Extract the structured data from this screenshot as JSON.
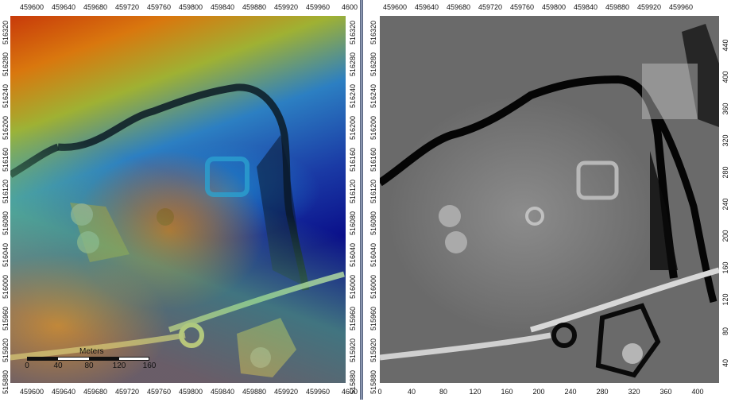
{
  "left_panel": {
    "x_axis_top": [
      "459600",
      "459640",
      "459680",
      "459720",
      "459760",
      "459800",
      "459840",
      "459880",
      "459920",
      "459960",
      "4600"
    ],
    "x_axis_bottom": [
      "459600",
      "459640",
      "459680",
      "459720",
      "459760",
      "459800",
      "459840",
      "459880",
      "459920",
      "459960",
      "4600"
    ],
    "y_axis": [
      "516320",
      "516280",
      "516240",
      "516200",
      "516160",
      "516120",
      "516080",
      "516040",
      "516000",
      "515960",
      "515920",
      "515880"
    ],
    "scale": {
      "title": "Meters",
      "labels": [
        "0",
        "40",
        "80",
        "120",
        "160"
      ]
    }
  },
  "right_panel": {
    "x_axis_top": [
      "459600",
      "459640",
      "459680",
      "459720",
      "459760",
      "459800",
      "459840",
      "459880",
      "459920",
      "459960"
    ],
    "y_axis_left": [
      "516320",
      "516280",
      "516240",
      "516200",
      "516160",
      "516120",
      "516080",
      "516040",
      "516000",
      "515960",
      "515920",
      "515880"
    ],
    "x_axis_bottom": [
      "0",
      "40",
      "80",
      "120",
      "160",
      "200",
      "240",
      "280",
      "320",
      "360",
      "400"
    ],
    "y_axis_right": [
      "440",
      "400",
      "360",
      "320",
      "280",
      "240",
      "200",
      "160",
      "120",
      "80",
      "40"
    ]
  },
  "colors": {
    "dem_high": "#c83a0a",
    "dem_mid": "#9fb133",
    "dem_low": "#0a0f8a",
    "hillshade": "#7a7a7a"
  }
}
